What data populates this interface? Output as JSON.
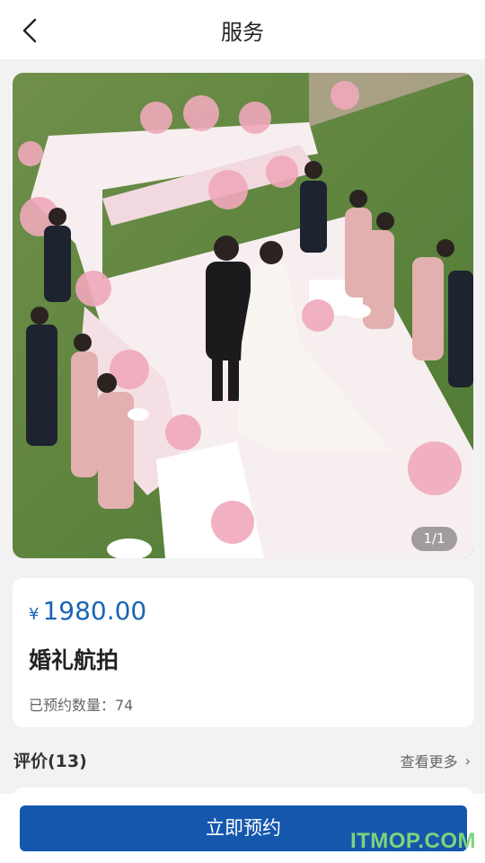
{
  "header": {
    "title": "服务"
  },
  "gallery": {
    "counter": "1/1"
  },
  "product": {
    "currency_symbol": "¥",
    "price": "1980.00",
    "name": "婚礼航拍",
    "booked_text": "已预约数量：74"
  },
  "reviews": {
    "label": "评价(13)",
    "see_more": "查看更多"
  },
  "footer": {
    "book_button": "立即预约"
  },
  "watermark": "ITMOP.COM",
  "colors": {
    "accent": "#1a64b4",
    "button": "#1457ad"
  },
  "icons": {
    "back": "chevron-left-icon",
    "more": "chevron-right-icon"
  }
}
